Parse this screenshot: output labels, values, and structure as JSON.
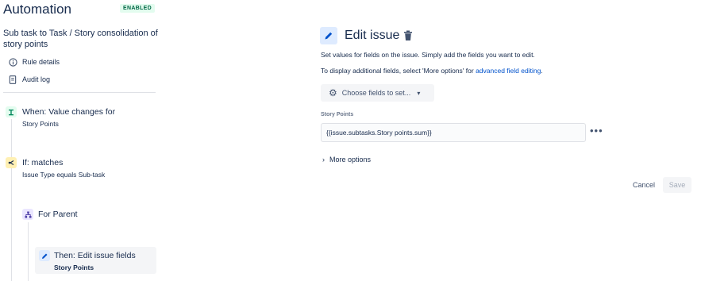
{
  "app": {
    "title": "Automation",
    "status_badge": "ENABLED"
  },
  "rule": {
    "name": "Sub task to Task / Story consolidation of story points"
  },
  "menu": [
    {
      "label": "Rule details",
      "icon": "info-icon"
    },
    {
      "label": "Audit log",
      "icon": "document-icon"
    }
  ],
  "steps": {
    "trigger": {
      "title": "When: Value changes for",
      "subtitle": "Story Points",
      "icon": "trigger-icon",
      "color": "#36b37e"
    },
    "condition": {
      "title": "If: matches",
      "subtitle": "Issue Type equals Sub-task",
      "icon": "condition-icon",
      "color": "#ffab00"
    },
    "branch": {
      "title": "For Parent",
      "icon": "branch-icon",
      "color": "#6554c0"
    },
    "action": {
      "title": "Then: Edit issue fields",
      "subtitle": "Story Points",
      "icon": "pencil-icon",
      "color": "#0052cc"
    }
  },
  "editor": {
    "title": "Edit issue",
    "description_1": "Set values for fields on the issue. Simply add the fields you want to edit.",
    "description_2_prefix": "To display additional fields, select 'More options' for ",
    "description_2_link": "advanced field editing",
    "description_2_suffix": ".",
    "choose_fields_label": "Choose fields to set...",
    "field_label": "Story Points",
    "field_value": "{{issue.subtasks.Story points.sum}}",
    "more_options_label": "More options",
    "cancel_label": "Cancel",
    "save_label": "Save"
  },
  "colors": {
    "accent": "#0052cc",
    "text": "#172b4d",
    "badge_bg": "#e3fcef",
    "badge_text": "#006644"
  }
}
